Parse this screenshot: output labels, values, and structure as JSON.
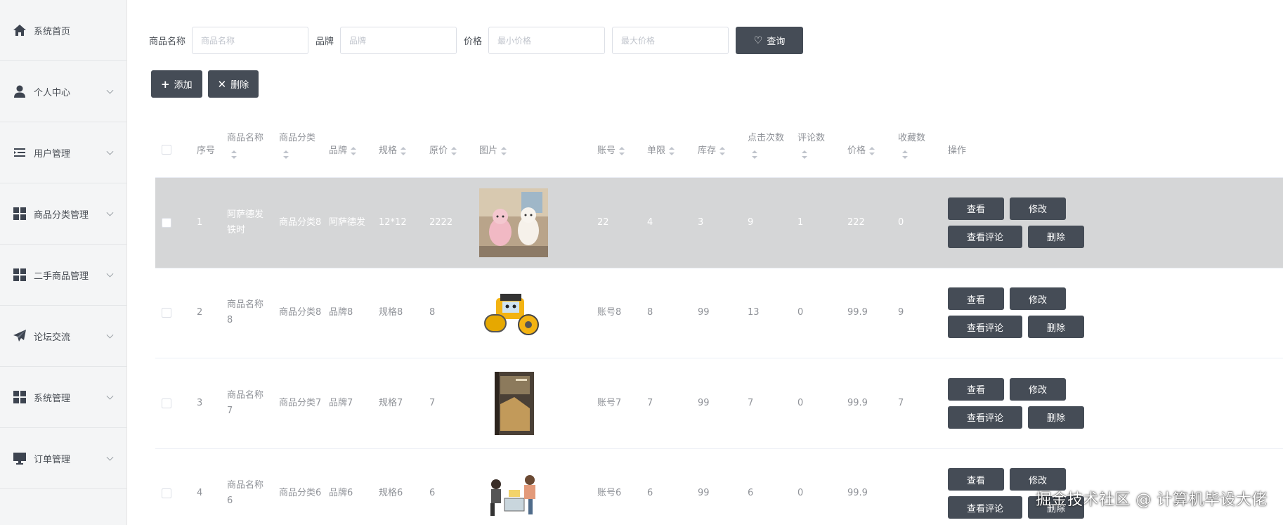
{
  "sidebar": {
    "items": [
      {
        "label": "系统首页",
        "icon": "home-icon",
        "expandable": false
      },
      {
        "label": "个人中心",
        "icon": "user-icon",
        "expandable": true
      },
      {
        "label": "用户管理",
        "icon": "list-indent-icon",
        "expandable": true
      },
      {
        "label": "商品分类管理",
        "icon": "grid-icon",
        "expandable": true
      },
      {
        "label": "二手商品管理",
        "icon": "grid-icon",
        "expandable": true
      },
      {
        "label": "论坛交流",
        "icon": "paper-plane-icon",
        "expandable": true
      },
      {
        "label": "系统管理",
        "icon": "grid-icon",
        "expandable": true
      },
      {
        "label": "订单管理",
        "icon": "monitor-icon",
        "expandable": true
      }
    ]
  },
  "search": {
    "name_label": "商品名称",
    "name_placeholder": "商品名称",
    "brand_label": "品牌",
    "brand_placeholder": "品牌",
    "price_label": "价格",
    "min_price_placeholder": "最小价格",
    "max_price_placeholder": "最大价格",
    "query_button": "查询"
  },
  "actions": {
    "add_button": "添加",
    "delete_button": "删除"
  },
  "table": {
    "headers": {
      "index": "序号",
      "name": "商品名称",
      "category": "商品分类",
      "brand": "品牌",
      "spec": "规格",
      "orig_price": "原价",
      "image": "图片",
      "account": "账号",
      "limit": "单限",
      "stock": "库存",
      "clicks": "点击次数",
      "comments": "评论数",
      "price": "价格",
      "favorites": "收藏数",
      "ops": "操作"
    },
    "op_labels": {
      "view": "查看",
      "edit": "修改",
      "view_comments": "查看评论",
      "delete": "删除"
    },
    "rows": [
      {
        "index": "1",
        "name": "阿萨德发铁时",
        "category": "商品分类8",
        "brand": "阿萨德发",
        "spec": "12*12",
        "orig_price": "2222",
        "image": "plush-toys",
        "account": "22",
        "limit": "4",
        "stock": "3",
        "clicks": "9",
        "comments": "1",
        "price": "222",
        "favorites": "0",
        "highlighted": true
      },
      {
        "index": "2",
        "name": "商品名称8",
        "category": "商品分类8",
        "brand": "品牌8",
        "spec": "规格8",
        "orig_price": "8",
        "image": "toy-roller",
        "account": "账号8",
        "limit": "8",
        "stock": "99",
        "clicks": "13",
        "comments": "0",
        "price": "99.9",
        "favorites": "9",
        "highlighted": false
      },
      {
        "index": "3",
        "name": "商品名称7",
        "category": "商品分类7",
        "brand": "品牌7",
        "spec": "规格7",
        "orig_price": "7",
        "image": "book",
        "account": "账号7",
        "limit": "7",
        "stock": "99",
        "clicks": "7",
        "comments": "0",
        "price": "99.9",
        "favorites": "7",
        "highlighted": false
      },
      {
        "index": "4",
        "name": "商品名称6",
        "category": "商品分类6",
        "brand": "品牌6",
        "spec": "规格6",
        "orig_price": "6",
        "image": "people-illustration",
        "account": "账号6",
        "limit": "6",
        "stock": "99",
        "clicks": "6",
        "comments": "0",
        "price": "99.9",
        "favorites": "",
        "highlighted": false
      }
    ]
  },
  "watermark": "掘金技术社区 @ 计算机毕设大佬",
  "colors": {
    "button_dark": "#454c56",
    "sidebar_bg": "#f4f5f6",
    "row_highlight": "#d5d6d7"
  }
}
